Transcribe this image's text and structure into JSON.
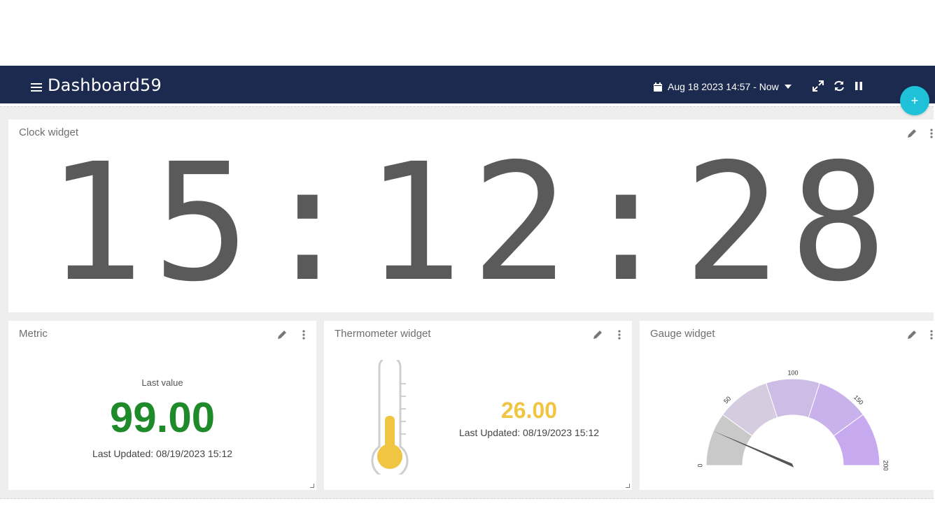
{
  "dashboard": {
    "title": "Dashboard59",
    "time_range": "Aug 18 2023 14:57 - Now"
  },
  "fab_label": "+",
  "widgets": {
    "clock": {
      "title": "Clock widget",
      "time": "15:12:28"
    },
    "metric": {
      "title": "Metric",
      "label": "Last value",
      "value": "99.00",
      "updated": "Last Updated: 08/19/2023 15:12",
      "value_color": "#1e8a2a"
    },
    "thermometer": {
      "title": "Thermometer widget",
      "value": "26.00",
      "updated": "Last Updated: 08/19/2023 15:12",
      "fill_color": "#f0c541"
    },
    "gauge": {
      "title": "Gauge widget",
      "min": 0,
      "max": 200,
      "value": 26,
      "ticks": [
        "0",
        "50",
        "100",
        "150",
        "200"
      ],
      "band_colors": [
        "#c9c9c9",
        "#d6cce0",
        "#cdbde6",
        "#c9b2ec",
        "#c7a9f0"
      ]
    }
  },
  "colors": {
    "header": "#1b2a4e",
    "accent": "#1ec1d8"
  }
}
